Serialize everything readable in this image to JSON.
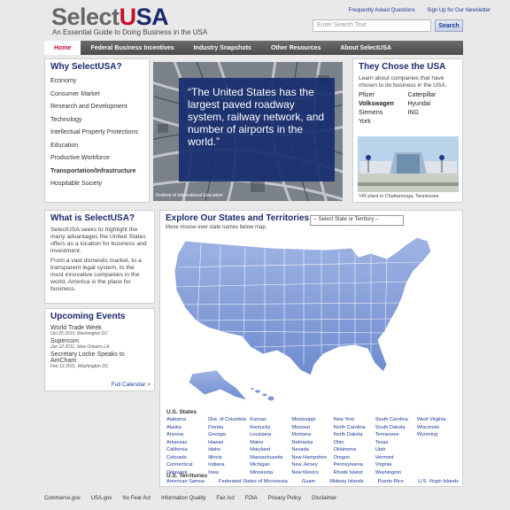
{
  "header": {
    "logo_part1": "Select",
    "logo_part2": "U",
    "logo_part3": "SA",
    "tagline": "An Essential Guide to Doing Business in the USA",
    "links": [
      "Frequently Asked Questions",
      "Sign Up for Our Newsletter"
    ],
    "search_placeholder": "Enter Search Text",
    "search_button": "Search"
  },
  "nav": {
    "tabs": [
      "Home",
      "Federal Business Incentives",
      "Industry Snapshots",
      "Other Resources",
      "About SelectUSA"
    ]
  },
  "why": {
    "title": "Why SelectUSA?",
    "items": [
      "Economy",
      "Consumer Market",
      "Research and Development",
      "Technology",
      "Intellectual Property Protections",
      "Education",
      "Productive Workforce",
      "Transportation/Infrastructure",
      "Hospitable Society"
    ]
  },
  "hero": {
    "quote": "“The United States has the largest paved roadway system, railway network, and number of airports in the world.”",
    "credit": "Institute of International Education"
  },
  "chose": {
    "title": "They Chose the USA",
    "intro": "Learn about companies that have chosen to do business in the USA.",
    "companies": [
      "Pfizer",
      "Caterpillar",
      "Volkswagen",
      "Hyundai",
      "Siemens",
      "ING",
      "York"
    ],
    "caption": "VW plant in Chattanooga, Tennessee"
  },
  "what": {
    "title": "What is SelectUSA?",
    "p1": "SelectUSA seeks to highlight the many advantages the United States offers as a location for business and investment.",
    "p2": "From a vast domestic market, to a transparent legal system, to the most innovative companies in the world, America is the place for business."
  },
  "events": {
    "title": "Upcoming Events",
    "items": [
      {
        "name": "World Trade Week",
        "meta": "Oct 25 2010, Washington DC"
      },
      {
        "name": "Supercom",
        "meta": "Jan 12 2011, New Orleans LA"
      },
      {
        "name": "Secretary Locke Speaks to AmCham",
        "meta": "Feb 12 2011, Washington DC"
      }
    ],
    "full_calendar": "Full Calendar >"
  },
  "map": {
    "title": "Explore Our States and Territories",
    "select_label": "-- Select State or Territory --",
    "hint": "Move mouse over state names below map.",
    "states_title": "U.S. States",
    "states": [
      "Alabama",
      "Alaska",
      "Arizona",
      "Arkansas",
      "California",
      "Colorado",
      "Connecticut",
      "Delaware",
      "Dist. of Columbia",
      "Florida",
      "Georgia",
      "Hawaii",
      "Idaho",
      "Illinois",
      "Indiana",
      "Iowa",
      "Kansas",
      "Kentucky",
      "Louisiana",
      "Maine",
      "Maryland",
      "Massachusetts",
      "Michigan",
      "Minnesota",
      "Mississippi",
      "Missouri",
      "Montana",
      "Nebraska",
      "Nevada",
      "New Hampshire",
      "New Jersey",
      "New Mexico",
      "New York",
      "North Carolina",
      "North Dakota",
      "Ohio",
      "Oklahoma",
      "Oregon",
      "Pennsylvania",
      "Rhode Island",
      "South Carolina",
      "South Dakota",
      "Tennessee",
      "Texas",
      "Utah",
      "Vermont",
      "Virginia",
      "Washington",
      "West Virginia",
      "Wisconsin",
      "Wyoming"
    ],
    "territories_title": "U.S. Territories",
    "territories": [
      "American Samoa",
      "Federated States of Micronesia",
      "Guam",
      "Midway Islands",
      "Puerto Rico",
      "U.S. Virgin Islands"
    ]
  },
  "footer": {
    "links": [
      "Commerce.gov",
      "USA.gov",
      "No Fear Act",
      "Information Quality",
      "Fair Act",
      "FOIA",
      "Privacy Policy",
      "Disclaimer"
    ]
  }
}
